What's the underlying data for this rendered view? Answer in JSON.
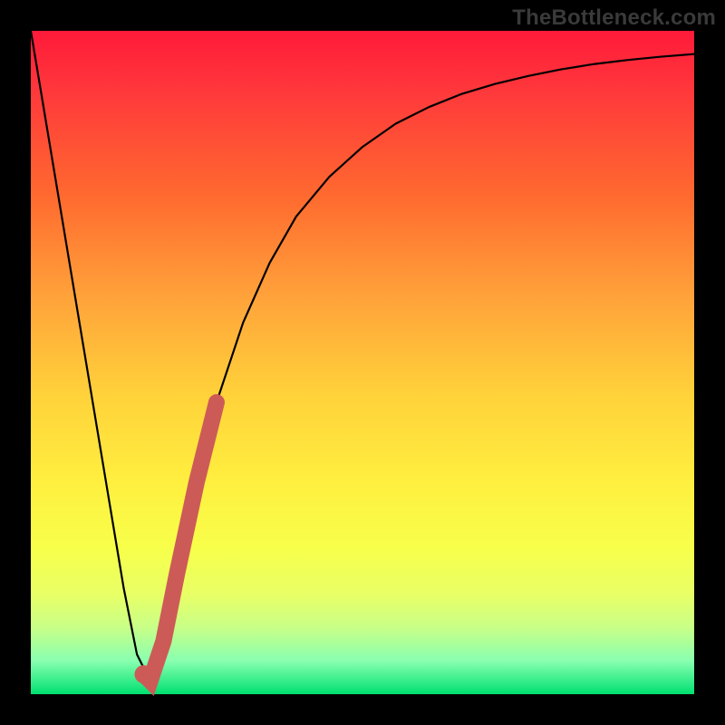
{
  "watermark": "TheBottleneck.com",
  "chart_data": {
    "type": "line",
    "title": "",
    "xlabel": "",
    "ylabel": "",
    "xlim": [
      0,
      100
    ],
    "ylim": [
      0,
      100
    ],
    "grid": false,
    "legend": false,
    "series": [
      {
        "name": "bottleneck-curve",
        "x": [
          0,
          2,
          4,
          6,
          8,
          10,
          12,
          14,
          16,
          18,
          20,
          22,
          25,
          28,
          32,
          36,
          40,
          45,
          50,
          55,
          60,
          65,
          70,
          75,
          80,
          85,
          90,
          95,
          100
        ],
        "y": [
          100,
          88,
          76,
          64,
          52,
          40,
          28,
          16,
          6,
          2,
          8,
          18,
          32,
          44,
          56,
          65,
          72,
          78,
          82.5,
          86,
          88.5,
          90.5,
          92,
          93.2,
          94.2,
          95,
          95.6,
          96.1,
          96.5
        ]
      }
    ],
    "highlight_segment": {
      "name": "red-marker",
      "x": [
        17,
        18,
        20,
        22,
        25,
        28
      ],
      "y": [
        3,
        2,
        8,
        18,
        32,
        44
      ]
    },
    "background_gradient": {
      "top": "#ff1a3a",
      "bottom": "#00e070"
    }
  }
}
